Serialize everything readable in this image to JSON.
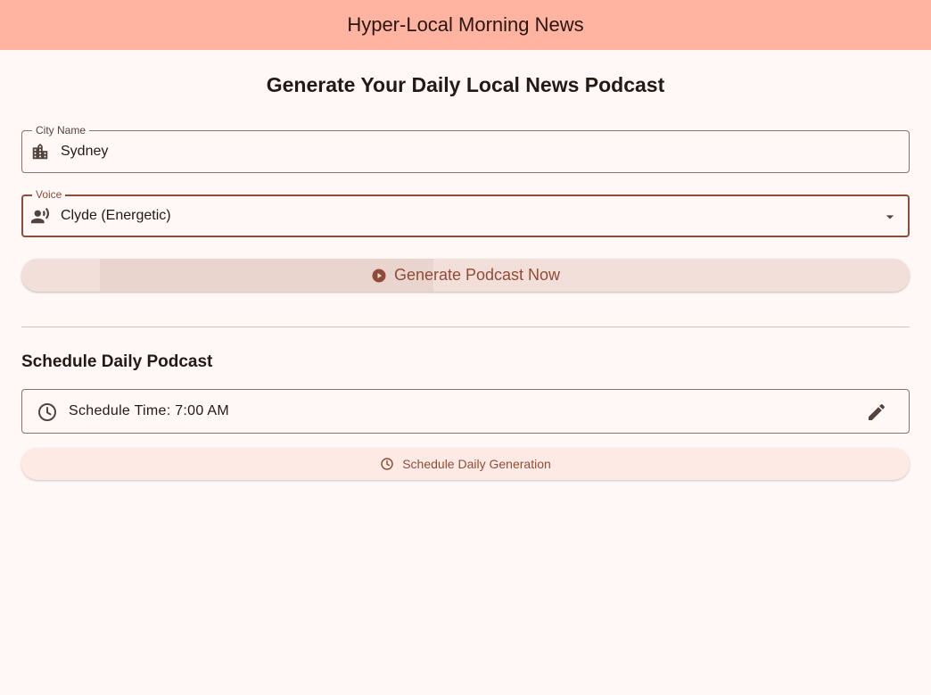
{
  "appbar": {
    "title": "Hyper-Local Morning News"
  },
  "main": {
    "title": "Generate Your Daily Local News Podcast",
    "city_field": {
      "label": "City Name",
      "value": "Sydney",
      "icon": "location-city-icon"
    },
    "voice_field": {
      "label": "Voice",
      "value": "Clyde (Energetic)",
      "icon": "record-voice-icon"
    },
    "generate_button": {
      "label": "Generate Podcast Now",
      "icon": "play-circle-icon"
    }
  },
  "schedule": {
    "section_title": "Schedule Daily Podcast",
    "time_tile": {
      "text": "Schedule Time: 7:00 AM",
      "icon": "clock-icon",
      "trailing_icon": "edit-icon"
    },
    "schedule_button": {
      "label": "Schedule Daily Generation",
      "icon": "clock-icon"
    }
  },
  "colors": {
    "appbar_bg": "#ffb4a2",
    "background": "#fff8f6",
    "accent": "#8f4c38"
  }
}
